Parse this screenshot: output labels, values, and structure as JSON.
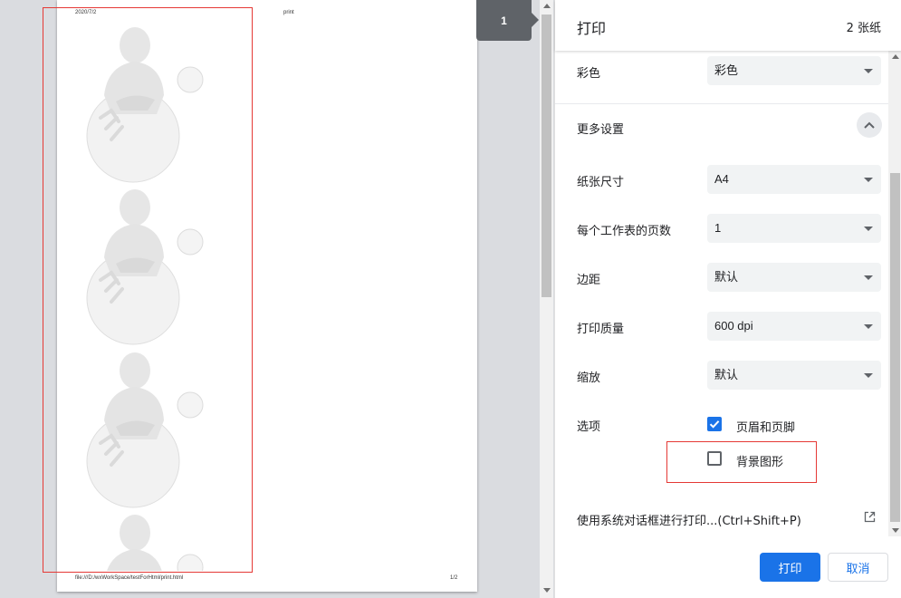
{
  "preview": {
    "page_number_badge": "1",
    "header_date": "2020/7/2",
    "header_title": "print",
    "footer_url": "file:///D:/wxWorkSpace/testForHtml/print.html",
    "footer_page": "1/2"
  },
  "panel": {
    "title": "打印",
    "sheet_count": "2 张纸",
    "color": {
      "label": "彩色",
      "value": "彩色"
    },
    "more_settings_label": "更多设置",
    "paper_size": {
      "label": "纸张尺寸",
      "value": "A4"
    },
    "pages_per_sheet": {
      "label": "每个工作表的页数",
      "value": "1"
    },
    "margins": {
      "label": "边距",
      "value": "默认"
    },
    "quality": {
      "label": "打印质量",
      "value": "600 dpi"
    },
    "scale": {
      "label": "缩放",
      "value": "默认"
    },
    "options": {
      "label": "选项",
      "headers_footers": {
        "label": "页眉和页脚",
        "checked": true
      },
      "background_graphics": {
        "label": "背景图形",
        "checked": false
      }
    },
    "system_dialog_label": "使用系统对话框进行打印...(Ctrl+Shift+P)",
    "print_button": "打印",
    "cancel_button": "取消"
  },
  "colors": {
    "accent": "#1a73e8",
    "highlight": "#e53935",
    "preview_bg": "#dadce0"
  }
}
